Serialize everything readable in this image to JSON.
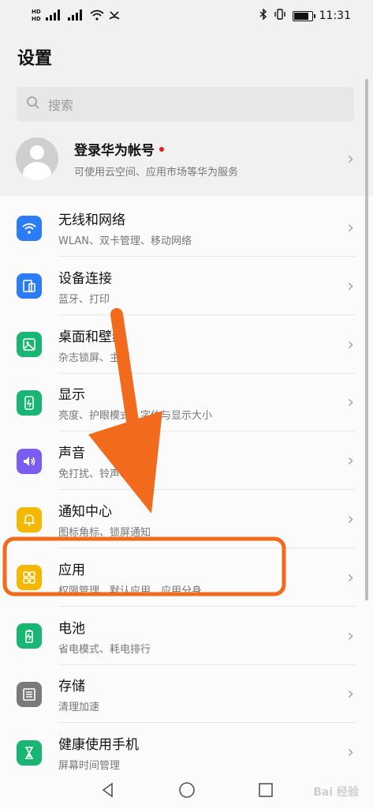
{
  "status_bar": {
    "left_signal_1": "⁴⁶",
    "left_signal_2": "⁴⁶",
    "hd1": "HD",
    "hd2": "HD",
    "time": "11:31",
    "battery_level": 0.85
  },
  "header": {
    "title": "设置"
  },
  "search": {
    "placeholder": "搜索"
  },
  "account": {
    "title": "登录华为帐号",
    "subtitle": "可使用云空间、应用市场等华为服务"
  },
  "items": [
    {
      "title": "无线和网络",
      "subtitle": "WLAN、双卡管理、移动网络",
      "icon": "wifi-icon",
      "color": "#2b7cf6"
    },
    {
      "title": "设备连接",
      "subtitle": "蓝牙、打印",
      "icon": "device-connect-icon",
      "color": "#2b7cf6"
    },
    {
      "title": "桌面和壁纸",
      "subtitle": "杂志锁屏、主题",
      "icon": "wallpaper-icon",
      "color": "#18b573"
    },
    {
      "title": "显示",
      "subtitle": "亮度、护眼模式、字体与显示大小",
      "icon": "display-icon",
      "color": "#18b573"
    },
    {
      "title": "声音",
      "subtitle": "免打扰、铃声、振动",
      "icon": "sound-icon",
      "color": "#7b5cf0"
    },
    {
      "title": "通知中心",
      "subtitle": "图标角标、锁屏通知",
      "icon": "bell-icon",
      "color": "#f5b800"
    },
    {
      "title": "应用",
      "subtitle": "权限管理、默认应用、应用分身",
      "icon": "apps-icon",
      "color": "#f5b800"
    },
    {
      "title": "电池",
      "subtitle": "省电模式、耗电排行",
      "icon": "battery-icon",
      "color": "#18b573"
    },
    {
      "title": "存储",
      "subtitle": "清理加速",
      "icon": "storage-icon",
      "color": "#7a7a7a"
    },
    {
      "title": "健康使用手机",
      "subtitle": "屏幕时间管理",
      "icon": "hourglass-icon",
      "color": "#18b573"
    }
  ],
  "annotation": {
    "highlight_color": "#f26a1b"
  },
  "watermark": "Bai 经验"
}
